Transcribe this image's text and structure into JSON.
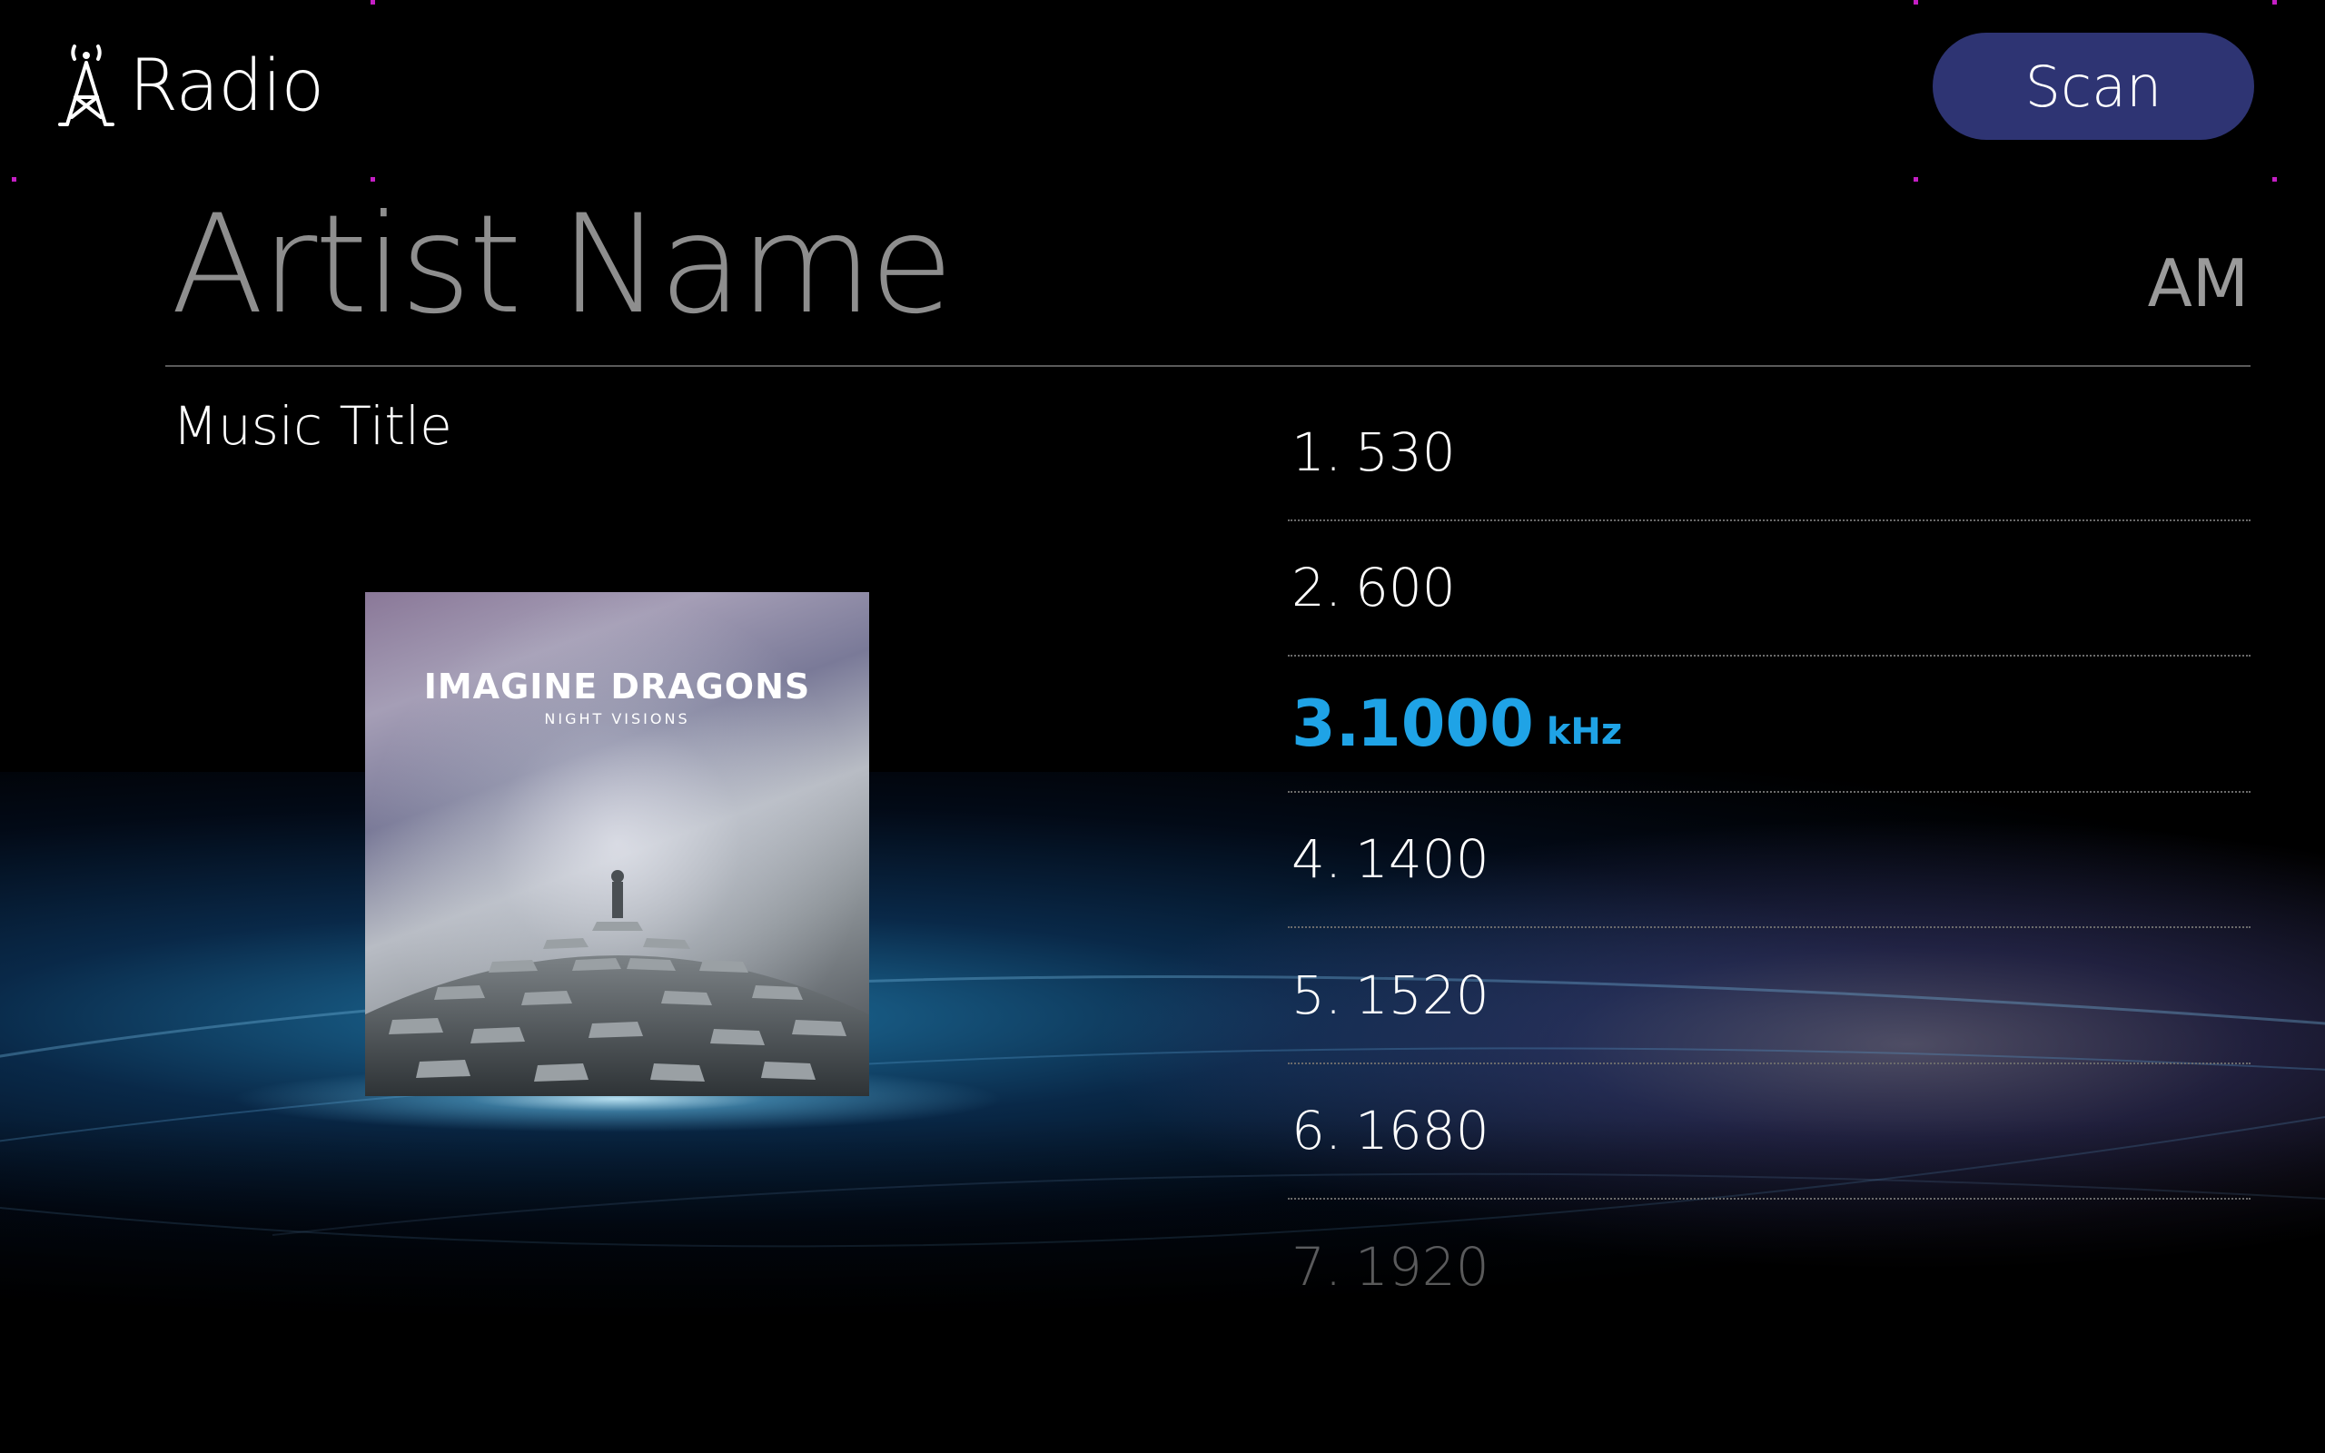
{
  "header": {
    "title": "Radio",
    "icon": "radio-tower-icon",
    "scan_label": "Scan"
  },
  "now_playing": {
    "artist": "Artist Name",
    "title": "Music Title",
    "band": "AM",
    "album_art": {
      "band_name": "IMAGINE DRAGONS",
      "album_name": "NIGHT VISIONS"
    }
  },
  "stations": [
    {
      "num": "1.",
      "freq": "530",
      "unit": "",
      "active": false
    },
    {
      "num": "2.",
      "freq": "600",
      "unit": "",
      "active": false
    },
    {
      "num": "3.",
      "freq": "1000",
      "unit": "kHz",
      "active": true
    },
    {
      "num": "4.",
      "freq": "1400",
      "unit": "",
      "active": false
    },
    {
      "num": "5.",
      "freq": "1520",
      "unit": "",
      "active": false
    },
    {
      "num": "6.",
      "freq": "1680",
      "unit": "",
      "active": false
    },
    {
      "num": "7.",
      "freq": "1920",
      "unit": "",
      "active": false
    }
  ],
  "colors": {
    "accent": "#1fa3e6",
    "scan_button": "#2e3473",
    "guide_markers": "#c41fc4"
  }
}
